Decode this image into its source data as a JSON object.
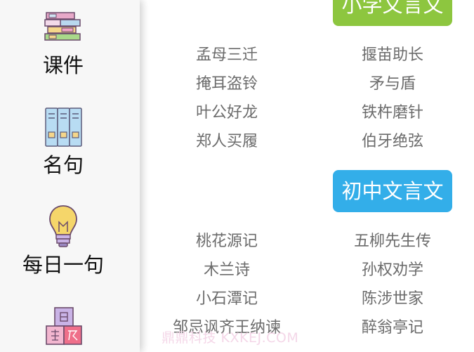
{
  "sidebar": {
    "items": [
      {
        "label": "课件",
        "icon": "books-icon"
      },
      {
        "label": "名句",
        "icon": "binders-icon"
      },
      {
        "label": "每日一句",
        "icon": "lightbulb-icon"
      },
      {
        "label": "",
        "icon": "character-blocks-icon"
      }
    ]
  },
  "sections": [
    {
      "title": "小学文言文",
      "color": "#8dc63f",
      "articles_left": [
        "孟母三迁",
        "掩耳盗铃",
        "叶公好龙",
        "郑人买履"
      ],
      "articles_right": [
        "揠苗助长",
        "矛与盾",
        "铁杵磨针",
        "伯牙绝弦"
      ]
    },
    {
      "title": "初中文言文",
      "color": "#33aee9",
      "articles_left": [
        "桃花源记",
        "木兰诗",
        "小石潭记",
        "邹忌讽齐王纳谏"
      ],
      "articles_right": [
        "五柳先生传",
        "孙权劝学",
        "陈涉世家",
        "醉翁亭记"
      ]
    }
  ],
  "watermark": "鼎鼎科技 KXKEJ.COM"
}
